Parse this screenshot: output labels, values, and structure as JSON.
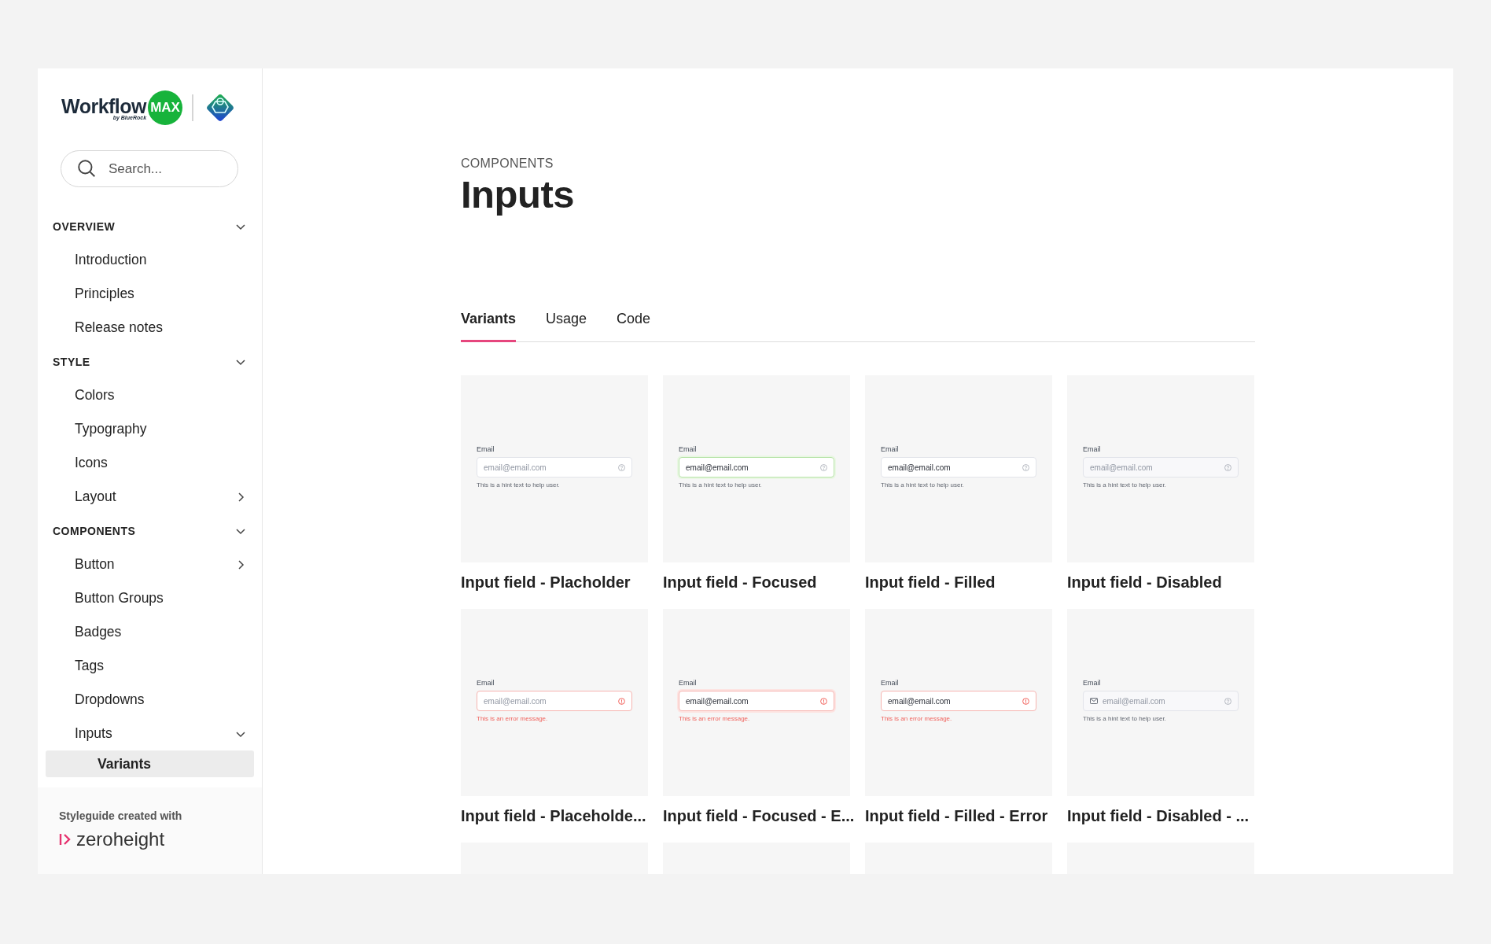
{
  "logo": {
    "word": "Workflow",
    "byline": "by BlueRock",
    "badge": "MAX"
  },
  "search": {
    "placeholder": "Search..."
  },
  "nav": [
    {
      "title": "OVERVIEW",
      "expanded": true,
      "items": [
        {
          "label": "Introduction",
          "selected": false
        },
        {
          "label": "Principles",
          "selected": false
        },
        {
          "label": "Release notes",
          "selected": false
        }
      ]
    },
    {
      "title": "STYLE",
      "expanded": true,
      "items": [
        {
          "label": "Colors",
          "selected": false
        },
        {
          "label": "Typography",
          "selected": false
        },
        {
          "label": "Icons",
          "selected": false
        },
        {
          "label": "Layout",
          "selected": false,
          "expanded": false
        }
      ]
    },
    {
      "title": "COMPONENTS",
      "expanded": true,
      "items": [
        {
          "label": "Button",
          "selected": false,
          "expanded": false
        },
        {
          "label": "Button Groups",
          "selected": false
        },
        {
          "label": "Badges",
          "selected": false
        },
        {
          "label": "Tags",
          "selected": false
        },
        {
          "label": "Dropdowns",
          "selected": false
        },
        {
          "label": "Inputs",
          "selected": false,
          "expanded": true,
          "children": [
            {
              "label": "Variants",
              "selected": true
            }
          ]
        }
      ]
    }
  ],
  "footer": {
    "caption": "Styleguide created with",
    "brand": "zeroheight"
  },
  "page": {
    "eyebrow": "COMPONENTS",
    "title": "Inputs"
  },
  "tabs": [
    {
      "label": "Variants",
      "selected": true
    },
    {
      "label": "Usage",
      "selected": false
    },
    {
      "label": "Code",
      "selected": false
    }
  ],
  "cards": [
    {
      "kind": "placeholder",
      "error": false,
      "leading_icon": false,
      "label": "Email",
      "value": "email@email.com",
      "message": "This is a hint text to help user.",
      "title": "Input field - Placholder"
    },
    {
      "kind": "focused",
      "error": false,
      "leading_icon": false,
      "label": "Email",
      "value": "email@email.com",
      "message": "This is a hint text to help user.",
      "title": "Input field - Focused"
    },
    {
      "kind": "filled",
      "error": false,
      "leading_icon": false,
      "label": "Email",
      "value": "email@email.com",
      "message": "This is a hint text to help user.",
      "title": "Input field - Filled"
    },
    {
      "kind": "disabled",
      "error": false,
      "leading_icon": false,
      "label": "Email",
      "value": "email@email.com",
      "message": "This is a hint text to help user.",
      "title": "Input field - Disabled"
    },
    {
      "kind": "placeholder",
      "error": true,
      "leading_icon": false,
      "label": "Email",
      "value": "email@email.com",
      "message": "This is an error message.",
      "title": "Input field - Placeholde..."
    },
    {
      "kind": "focused",
      "error": true,
      "leading_icon": false,
      "label": "Email",
      "value": "email@email.com",
      "message": "This is an error message.",
      "title": "Input field - Focused - E..."
    },
    {
      "kind": "filled",
      "error": true,
      "leading_icon": false,
      "label": "Email",
      "value": "email@email.com",
      "message": "This is an error message.",
      "title": "Input field - Filled - Error"
    },
    {
      "kind": "disabled",
      "error": false,
      "leading_icon": true,
      "label": "Email",
      "value": "email@email.com",
      "message": "This is a hint text to help user.",
      "title": "Input field - Disabled - ..."
    },
    {
      "kind": "blank"
    },
    {
      "kind": "blank"
    },
    {
      "kind": "blank"
    },
    {
      "kind": "blank"
    }
  ]
}
